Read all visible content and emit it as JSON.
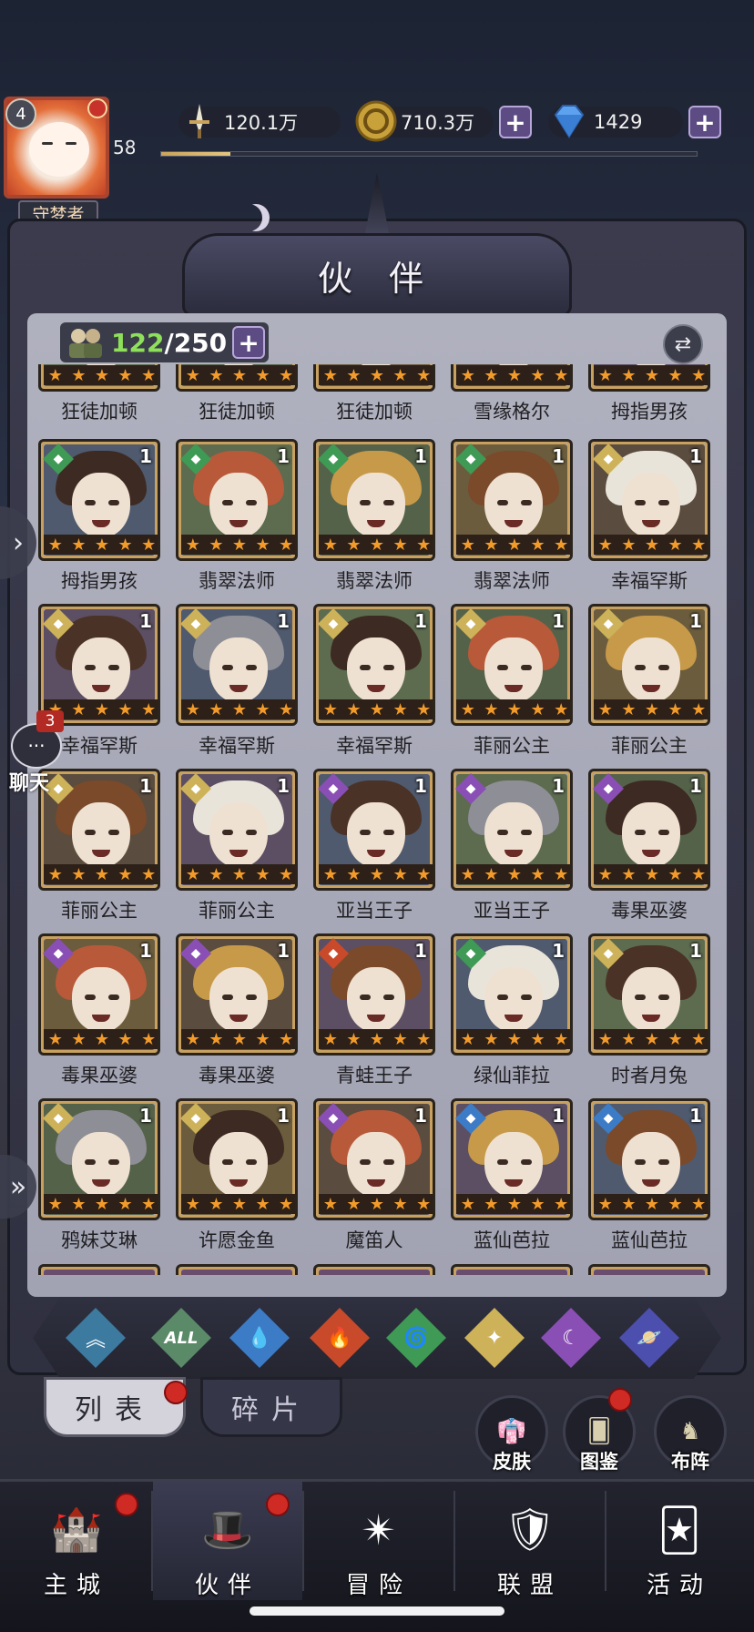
{
  "player": {
    "level": "4",
    "exp_level": "58",
    "title": "守梦者",
    "exp_fraction": 0.13
  },
  "resources": {
    "power": {
      "value": "120.1万",
      "icon": "sword-icon"
    },
    "gold": {
      "value": "710.3万",
      "icon": "gold-coin-icon"
    },
    "diamond": {
      "value": "1429",
      "icon": "diamond-icon"
    }
  },
  "panel": {
    "title": "伙 伴"
  },
  "roster": {
    "current": "122",
    "max": "250",
    "separator": "/"
  },
  "heroes": [
    {
      "name": "狂徒加顿",
      "element": "",
      "copies": ""
    },
    {
      "name": "狂徒加顿",
      "element": "",
      "copies": ""
    },
    {
      "name": "狂徒加顿",
      "element": "",
      "copies": ""
    },
    {
      "name": "雪缘格尔",
      "element": "",
      "copies": ""
    },
    {
      "name": "拇指男孩",
      "element": "",
      "copies": ""
    },
    {
      "name": "拇指男孩",
      "element": "wind",
      "copies": "1"
    },
    {
      "name": "翡翠法师",
      "element": "wind",
      "copies": "1"
    },
    {
      "name": "翡翠法师",
      "element": "wind",
      "copies": "1"
    },
    {
      "name": "翡翠法师",
      "element": "wind",
      "copies": "1"
    },
    {
      "name": "幸福罕斯",
      "element": "light",
      "copies": "1"
    },
    {
      "name": "幸福罕斯",
      "element": "light",
      "copies": "1"
    },
    {
      "name": "幸福罕斯",
      "element": "light",
      "copies": "1"
    },
    {
      "name": "幸福罕斯",
      "element": "light",
      "copies": "1"
    },
    {
      "name": "菲丽公主",
      "element": "light",
      "copies": "1"
    },
    {
      "name": "菲丽公主",
      "element": "light",
      "copies": "1"
    },
    {
      "name": "菲丽公主",
      "element": "light",
      "copies": "1"
    },
    {
      "name": "菲丽公主",
      "element": "light",
      "copies": "1"
    },
    {
      "name": "亚当王子",
      "element": "dark",
      "copies": "1"
    },
    {
      "name": "亚当王子",
      "element": "dark",
      "copies": "1"
    },
    {
      "name": "毒果巫婆",
      "element": "dark",
      "copies": "1"
    },
    {
      "name": "毒果巫婆",
      "element": "dark",
      "copies": "1"
    },
    {
      "name": "毒果巫婆",
      "element": "dark",
      "copies": "1"
    },
    {
      "name": "青蛙王子",
      "element": "fire",
      "copies": "1"
    },
    {
      "name": "绿仙菲拉",
      "element": "wind",
      "copies": "1"
    },
    {
      "name": "时者月兔",
      "element": "light",
      "copies": "1"
    },
    {
      "name": "鸦妹艾琳",
      "element": "light",
      "copies": "1"
    },
    {
      "name": "许愿金鱼",
      "element": "light",
      "copies": "1"
    },
    {
      "name": "魔笛人",
      "element": "dark",
      "copies": "1"
    },
    {
      "name": "蓝仙芭拉",
      "element": "water",
      "copies": "1"
    },
    {
      "name": "蓝仙芭拉",
      "element": "water",
      "copies": "1"
    }
  ],
  "element_colors": {
    "wind": "#3f9a55",
    "light": "#cdb25a",
    "dark": "#8a4fb5",
    "fire": "#c94a2a",
    "water": "#3c7cc7",
    "": "#6d6a72"
  },
  "filters": [
    {
      "id": "ascend",
      "label": "",
      "icon": "ascend-icon",
      "color": "#3d7aa0"
    },
    {
      "id": "all",
      "label": "ALL",
      "icon": "all-icon",
      "color": "#5a8a68"
    },
    {
      "id": "water",
      "label": "",
      "icon": "water-drop-icon",
      "color": "#3c7cc7"
    },
    {
      "id": "fire",
      "label": "",
      "icon": "flame-icon",
      "color": "#c94a2a"
    },
    {
      "id": "wind",
      "label": "",
      "icon": "wind-icon",
      "color": "#3f9a55"
    },
    {
      "id": "light",
      "label": "",
      "icon": "sun-icon",
      "color": "#cdb25a"
    },
    {
      "id": "dark",
      "label": "",
      "icon": "moon-icon",
      "color": "#8a4fb5"
    },
    {
      "id": "space",
      "label": "",
      "icon": "planet-icon",
      "color": "#4c4fae"
    }
  ],
  "sub_tabs": {
    "list": "列表",
    "fragments": "碎片"
  },
  "actions": {
    "skins": "皮肤",
    "codex": "图鉴",
    "formation": "布阵"
  },
  "chat": {
    "label": "聊天",
    "count": "3"
  },
  "nav": [
    {
      "label": "主城",
      "icon": "castle-icon"
    },
    {
      "label": "伙伴",
      "icon": "witch-hat-icon"
    },
    {
      "label": "冒险",
      "icon": "compass-icon"
    },
    {
      "label": "联盟",
      "icon": "shield-icon"
    },
    {
      "label": "活动",
      "icon": "cards-icon"
    }
  ]
}
